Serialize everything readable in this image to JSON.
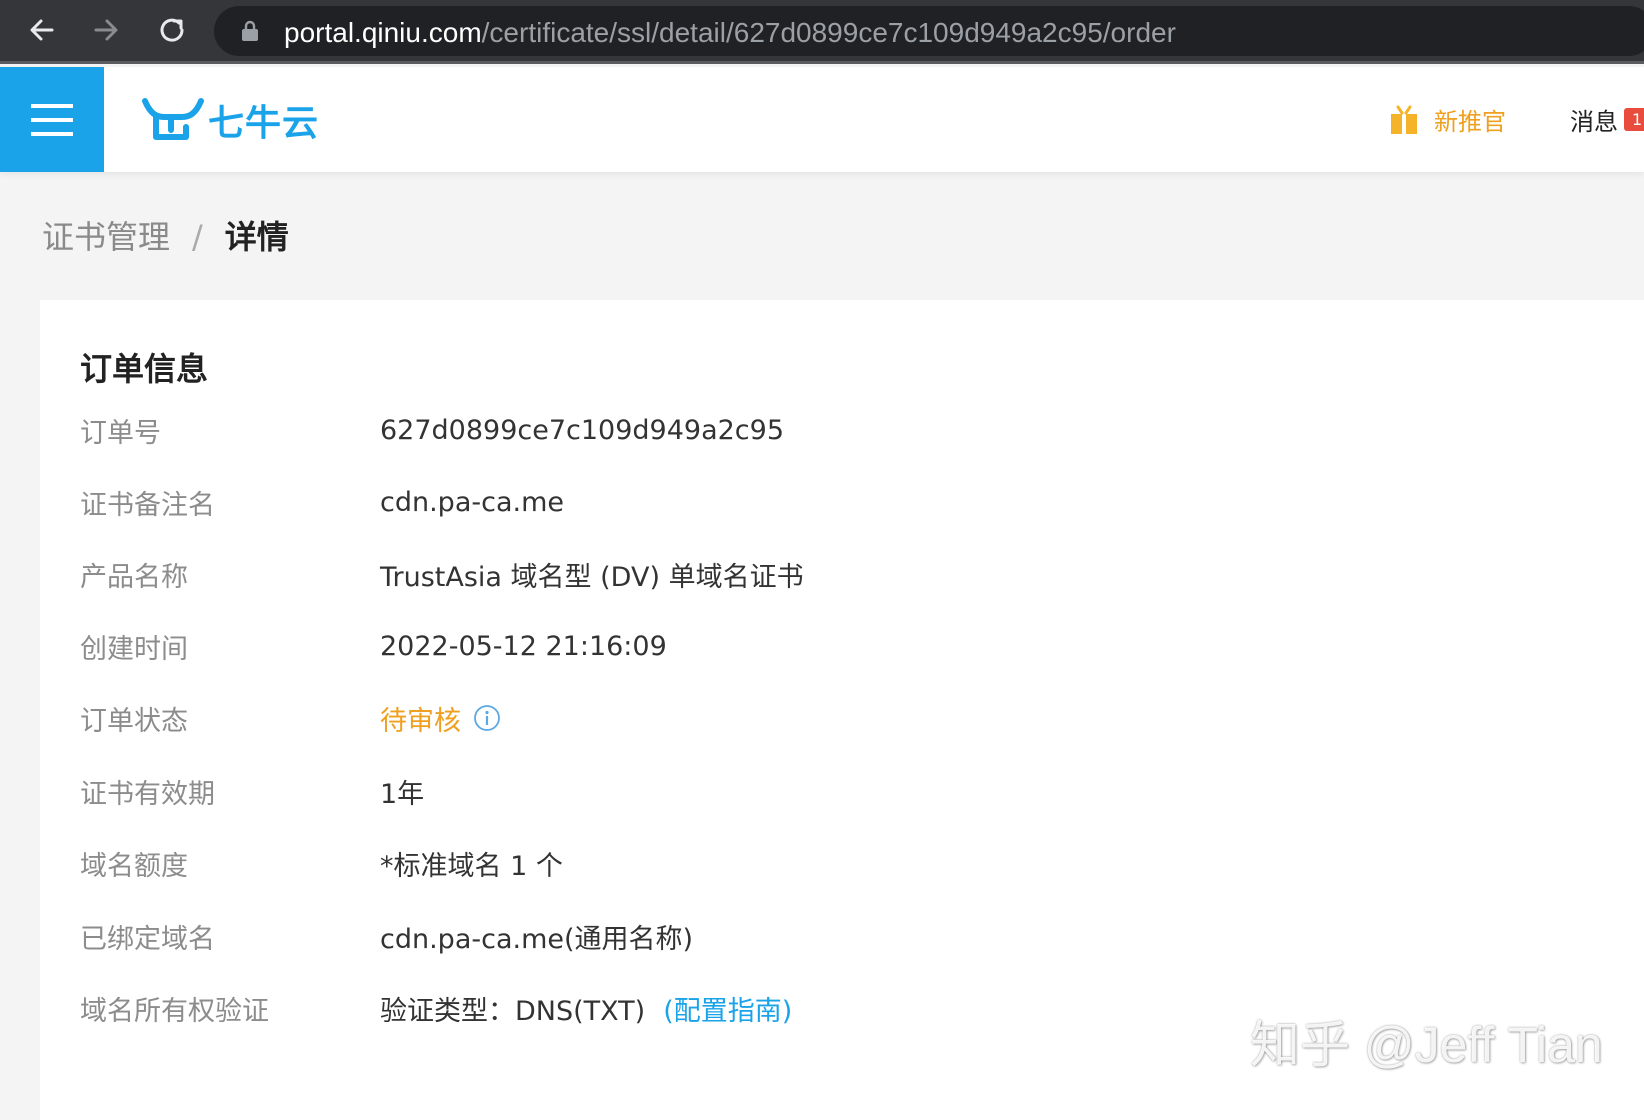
{
  "browser": {
    "url_host": "portal.qiniu.com",
    "url_path": "/certificate/ssl/detail/627d0899ce7c109d949a2c95/order"
  },
  "header": {
    "logo_text": "七牛云",
    "promo_label": "新推官",
    "messages_label": "消息",
    "messages_badge": "1",
    "accent_color": "#1aa3e8"
  },
  "breadcrumb": {
    "parent": "证书管理",
    "separator": "/",
    "current": "详情"
  },
  "order": {
    "title": "订单信息",
    "rows": [
      {
        "label": "订单号",
        "value": "627d0899ce7c109d949a2c95"
      },
      {
        "label": "证书备注名",
        "value": "cdn.pa-ca.me"
      },
      {
        "label": "产品名称",
        "value": "TrustAsia 域名型 (DV) 单域名证书"
      },
      {
        "label": "创建时间",
        "value": "2022-05-12 21:16:09"
      },
      {
        "label": "订单状态",
        "value": "待审核",
        "status_color": "#f0a020",
        "icon": "info-icon"
      },
      {
        "label": "证书有效期",
        "value": "1年"
      },
      {
        "label": "域名额度",
        "value": "*标准域名 1 个"
      },
      {
        "label": "已绑定域名",
        "value": "cdn.pa-ca.me(通用名称)"
      },
      {
        "label": "域名所有权验证",
        "value": "验证类型：DNS(TXT)",
        "link": "(配置指南)"
      }
    ]
  },
  "watermark": "知乎 @Jeff Tian"
}
